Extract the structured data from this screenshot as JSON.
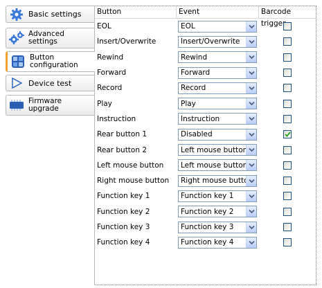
{
  "tabs": [
    {
      "label": "Basic settings",
      "icon": "gear-icon",
      "active": false
    },
    {
      "label": "Advanced\nsettings",
      "icon": "gears-icon",
      "active": false
    },
    {
      "label": "Button\nconfiguration",
      "icon": "button-config-icon",
      "active": true
    },
    {
      "label": "Device test",
      "icon": "play-icon",
      "active": false
    },
    {
      "label": "Firmware\nupgrade",
      "icon": "firmware-icon",
      "active": false
    }
  ],
  "table": {
    "headers": {
      "button": "Button",
      "event": "Event",
      "barcode": "Barcode trigger"
    },
    "rows": [
      {
        "button": "EOL",
        "event": "EOL",
        "barcode": false
      },
      {
        "button": "Insert/Overwrite",
        "event": "Insert/Overwrite",
        "barcode": false
      },
      {
        "button": "Rewind",
        "event": "Rewind",
        "barcode": false
      },
      {
        "button": "Forward",
        "event": "Forward",
        "barcode": false
      },
      {
        "button": "Record",
        "event": "Record",
        "barcode": false
      },
      {
        "button": "Play",
        "event": "Play",
        "barcode": false
      },
      {
        "button": "Instruction",
        "event": "Instruction",
        "barcode": false
      },
      {
        "button": "Rear button 1",
        "event": "Disabled",
        "barcode": true
      },
      {
        "button": "Rear button 2",
        "event": "Left mouse button",
        "barcode": false
      },
      {
        "button": "Left mouse button",
        "event": "Left mouse button",
        "barcode": false
      },
      {
        "button": "Right mouse button",
        "event": "Right mouse button",
        "barcode": false
      },
      {
        "button": "Function key 1",
        "event": "Function key 1",
        "barcode": false
      },
      {
        "button": "Function key 2",
        "event": "Function key 2",
        "barcode": false
      },
      {
        "button": "Function key 3",
        "event": "Function key 3",
        "barcode": false
      },
      {
        "button": "Function key 4",
        "event": "Function key 4",
        "barcode": false
      }
    ]
  },
  "colors": {
    "accent": "#f2a22f",
    "check": "#21a121",
    "arrow": "#4d6185"
  }
}
